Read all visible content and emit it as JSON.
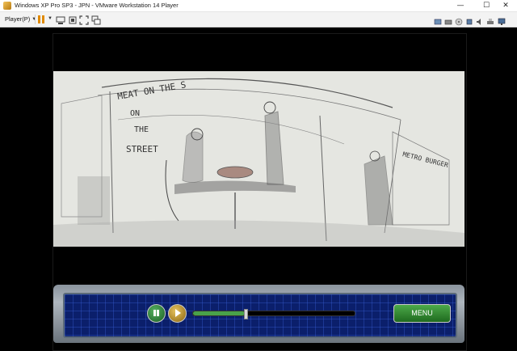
{
  "window": {
    "title": "Windows XP Pro SP3 - JPN - VMware Workstation 14 Player",
    "controls": {
      "minimize": "—",
      "maximize": "☐",
      "close": "✕"
    }
  },
  "toolbar": {
    "player_menu": "Player(P)",
    "buttons": [
      "pause-icon",
      "send-ctrl-alt-del-icon",
      "fit-guest-icon",
      "fullscreen-icon",
      "unity-icon"
    ],
    "device_icons": [
      "network-adapter-icon",
      "hard-disk-icon",
      "cd-drive-icon",
      "usb-icon",
      "sound-icon",
      "printer-icon",
      "display-icon"
    ]
  },
  "video": {
    "sign_text_1": "MEAT ON THE S",
    "sign_text_2": "ON",
    "sign_text_3": "THE",
    "sign_text_4": "STREET",
    "sign_text_5": "METRO BURGER"
  },
  "player_controls": {
    "menu_label": "MENU",
    "progress": 0.32,
    "colors": {
      "panel_bg": "#0b1f6b",
      "progress": "#4aa24a",
      "menu_button": "#2f8a2f"
    }
  }
}
